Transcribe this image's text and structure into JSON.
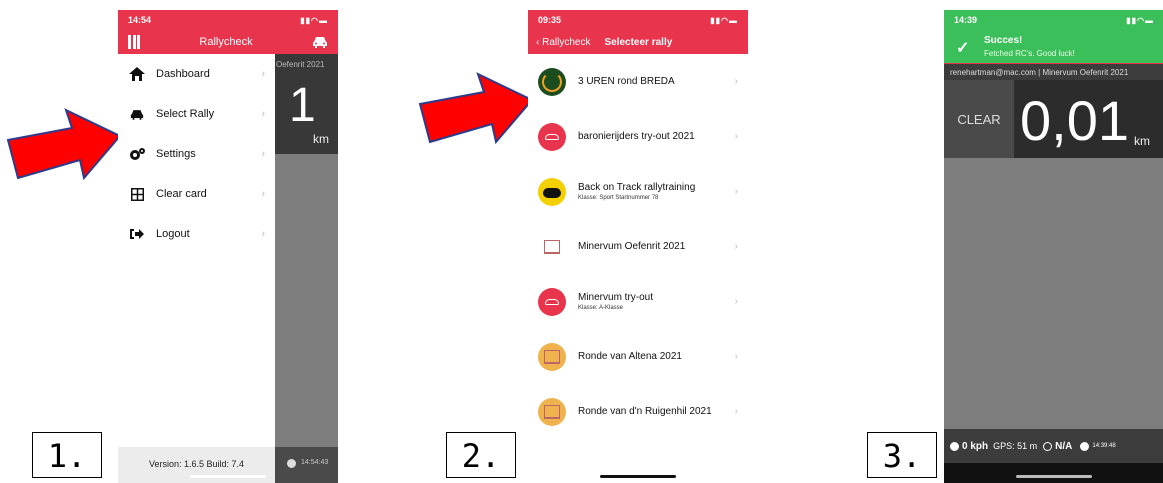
{
  "step_labels": [
    "1.",
    "2.",
    "3."
  ],
  "accent": "#e8344c",
  "success": "#3bbf5a",
  "arrow_color": "#ff0000",
  "phone1": {
    "time": "14:54",
    "header_title": "Rallycheck",
    "menu": [
      {
        "label": "Dashboard",
        "icon": "home-icon"
      },
      {
        "label": "Select Rally",
        "icon": "car-icon"
      },
      {
        "label": "Settings",
        "icon": "gears-icon"
      },
      {
        "label": "Clear card",
        "icon": "grid-icon"
      },
      {
        "label": "Logout",
        "icon": "logout-icon"
      }
    ],
    "version": "Version: 1.6.5 Build: 7.4",
    "bg_rally": "Oefenrit 2021",
    "bg_digit": "1",
    "bg_unit": "km",
    "bg_clock": "14:54:43"
  },
  "phone2": {
    "time": "09:35",
    "back_label": "Rallycheck",
    "title": "Selecteer rally",
    "rallies": [
      {
        "name": "3 UREN rond BREDA",
        "sub": ""
      },
      {
        "name": "baronierijders try-out 2021",
        "sub": ""
      },
      {
        "name": "Back on Track rallytraining",
        "sub": "Klasse: Sport Startnummer 78"
      },
      {
        "name": "Minervum Oefenrit 2021",
        "sub": ""
      },
      {
        "name": "Minervum try-out",
        "sub": "Klasse: A-Klasse"
      },
      {
        "name": "Ronde van Altena 2021",
        "sub": ""
      },
      {
        "name": "Ronde van d'n Ruigenhil 2021",
        "sub": ""
      }
    ]
  },
  "phone3": {
    "time": "14:39",
    "toast_title": "Succes!",
    "toast_sub": "Fetched RC's. Good luck!",
    "info": "renehartman@mac.com | Minervum Oefenrit 2021",
    "clear_label": "CLEAR",
    "counter": "0,01",
    "unit": "km",
    "speed": "0 kph",
    "gps": "GPS: 51 m",
    "status": "N/A",
    "clock": "14:39:48"
  }
}
